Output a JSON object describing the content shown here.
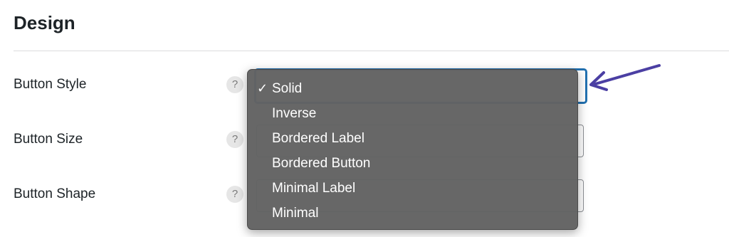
{
  "section": {
    "title": "Design"
  },
  "fields": [
    {
      "label": "Button Style",
      "help": "?"
    },
    {
      "label": "Button Size",
      "help": "?"
    },
    {
      "label": "Button Shape",
      "help": "?"
    }
  ],
  "dropdown": {
    "selected_mark": "✓",
    "selected": "Solid",
    "options": [
      "Solid",
      "Inverse",
      "Bordered Label",
      "Bordered Button",
      "Minimal Label",
      "Minimal"
    ]
  },
  "colors": {
    "accent": "#2271b1",
    "annotation_arrow": "#4b3fa3",
    "dropdown_bg": "#626262"
  },
  "icons": {
    "help": "question-circle-icon",
    "selected": "checkmark-icon",
    "annotation": "pointer-arrow-icon"
  }
}
